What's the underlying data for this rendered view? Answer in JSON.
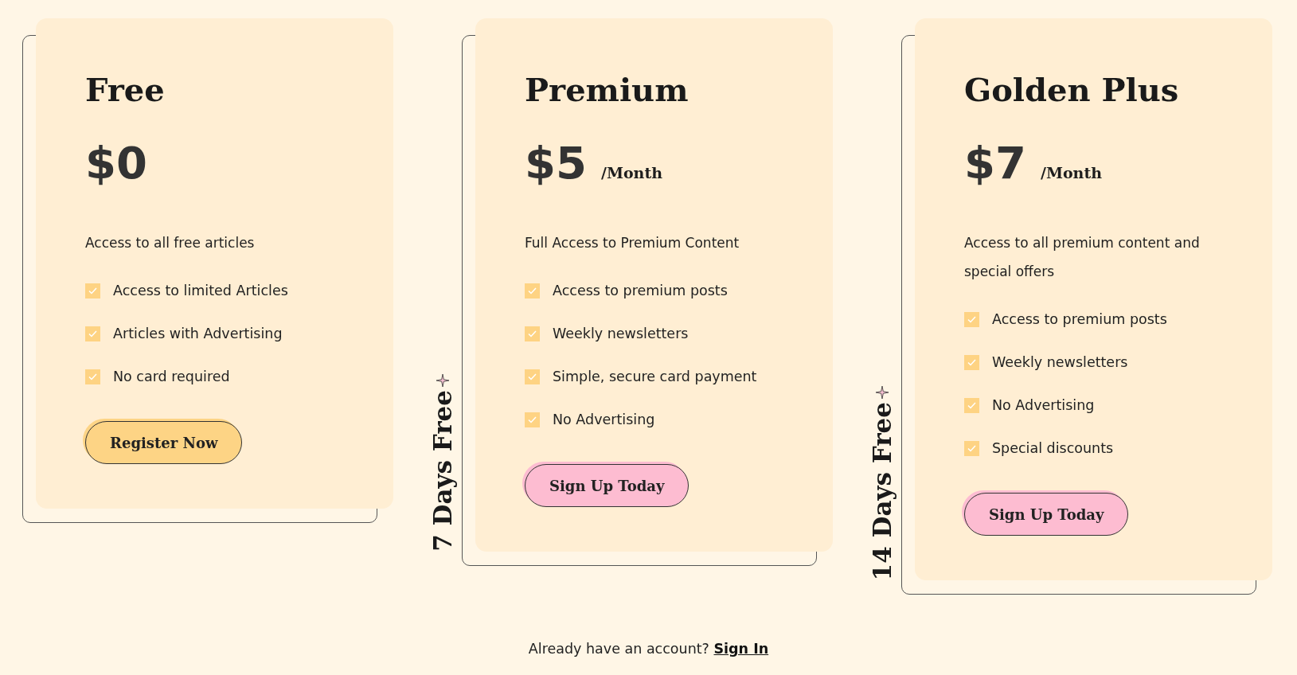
{
  "plans": [
    {
      "name": "Free",
      "price": "$0",
      "subtitle": "Access to all free articles",
      "features": [
        {
          "label": "Access to limited Articles",
          "checked": true
        },
        {
          "label": "Articles with Advertising",
          "checked": true
        },
        {
          "label": "No card required",
          "checked": true
        }
      ],
      "button": {
        "label": "Register Now",
        "color": "#fdd485"
      }
    },
    {
      "name": "Premium",
      "price": "$5",
      "period": "/Month",
      "trial": "7 Days Free",
      "subtitle": "Full Access to Premium Content",
      "features": [
        {
          "label": "Access to premium posts",
          "checked": true
        },
        {
          "label": "Weekly newsletters",
          "checked": true
        },
        {
          "label": "Simple, secure card payment",
          "checked": true
        },
        {
          "label": "No Advertising",
          "checked": true
        }
      ],
      "button": {
        "label": "Sign Up Today",
        "color": "#fdbcd1"
      }
    },
    {
      "name": "Golden Plus",
      "price": "$7",
      "period": "/Month",
      "trial": "14 Days Free",
      "subtitle": "Access to all premium content and special offers",
      "features": [
        {
          "label": "Access to premium posts",
          "checked": true
        },
        {
          "label": "Weekly newsletters",
          "checked": true
        },
        {
          "label": "No Advertising",
          "checked": true
        },
        {
          "label": "Special discounts",
          "checked": true
        }
      ],
      "button": {
        "label": "Sign Up Today",
        "color": "#fdbcd1"
      }
    }
  ],
  "footer": {
    "text": "Already have an account?",
    "link": "Sign In"
  }
}
